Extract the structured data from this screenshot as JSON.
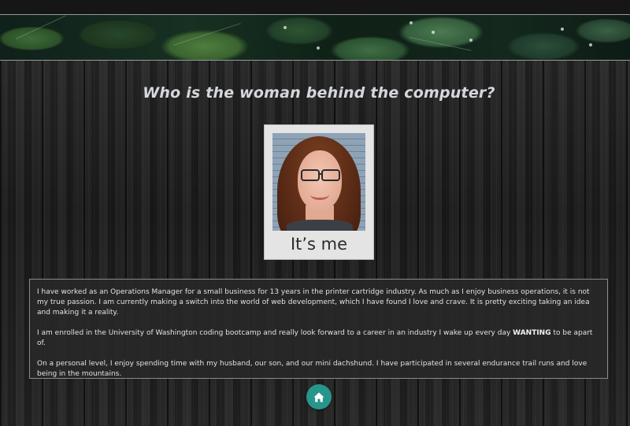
{
  "header": {
    "banner_image": "green-leaves-with-water-drops"
  },
  "main": {
    "title": "Who is the woman behind the computer?",
    "photo": {
      "subject": "portrait-photo",
      "caption": "It’s me"
    },
    "about": {
      "paragraph1": "I have worked as an Operations Manager for a small business for 13 years in the printer cartridge industry. As much as I enjoy business operations, it is not my true passion. I am currently making a switch into the world of web development, which I have found I love and crave. It is pretty exciting taking an idea and making it a reality.",
      "paragraph2_before": "I am enrolled in the University of Washington coding bootcamp and really look forward to a career in an industry I wake up every day ",
      "paragraph2_emphasis": "WANTING",
      "paragraph2_after": " to be apart of.",
      "paragraph3": "On a personal level, I enjoy spending time with my husband, our son, and our mini dachshund. I have participated in several endurance trail runs and love being in the mountains."
    }
  },
  "footer": {
    "home_icon": "home-icon"
  },
  "colors": {
    "accent": "#27958c",
    "title_text": "#d4d7dc",
    "body_text": "#e2e2e2",
    "polaroid_frame": "#e4e4e4"
  }
}
